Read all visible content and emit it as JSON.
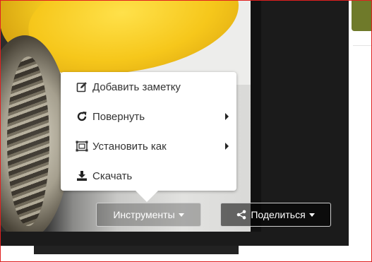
{
  "menu": {
    "items": [
      {
        "label": "Добавить заметку",
        "icon": "edit-icon",
        "submenu": false
      },
      {
        "label": "Повернуть",
        "icon": "rotate-icon",
        "submenu": true
      },
      {
        "label": "Установить как",
        "icon": "crop-icon",
        "submenu": true
      },
      {
        "label": "Скачать",
        "icon": "download-icon",
        "submenu": false
      }
    ]
  },
  "toolbar": {
    "tools_label": "Инструменты",
    "share_label": "Поделиться"
  },
  "colors": {
    "border": "#e02020",
    "menu_text": "#333333",
    "accent_green": "#6f7a2a"
  }
}
